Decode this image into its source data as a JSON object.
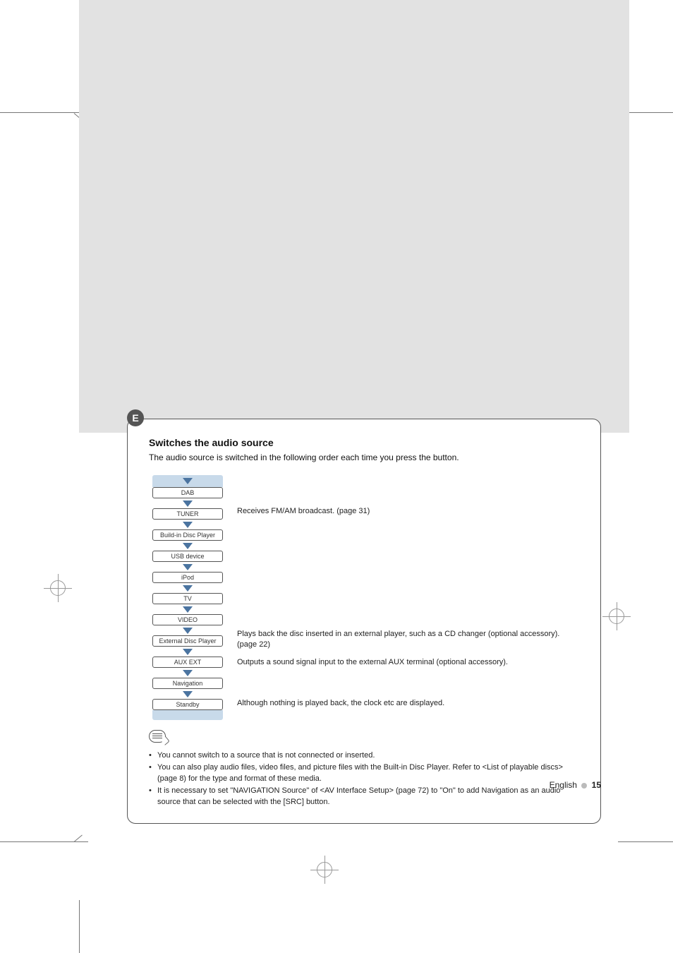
{
  "badge": "E",
  "title": "Switches the audio source",
  "subtitle": "The audio source is switched in the following order each time you press the button.",
  "flow": {
    "dab": "DAB",
    "tuner": "TUNER",
    "builtin": "Build-in Disc Player",
    "usb": "USB device",
    "ipod": "iPod",
    "tv": "TV",
    "video": "VIDEO",
    "external": "External Disc Player",
    "aux": "AUX EXT",
    "nav": "Navigation",
    "standby": "Standby"
  },
  "desc": {
    "tuner": "Receives FM/AM broadcast. (page 31)",
    "external": "Plays back the disc inserted in an external player, such as a CD changer (optional accessory). (page 22)",
    "aux": "Outputs a sound signal input to the external AUX terminal (optional accessory).",
    "standby": "Although nothing is played back, the clock etc are displayed."
  },
  "notes": [
    "You cannot switch to a source that is not connected or inserted.",
    "You can also play audio files, video files, and picture files with the Built-in Disc Player. Refer to <List of playable discs> (page 8) for the type and format of these media.",
    "It is necessary to set \"NAVIGATION Source\" of <AV Interface Setup> (page 72) to \"On\" to add Navigation as an audio source that can be selected with the [SRC] button."
  ],
  "footer": {
    "language": "English",
    "page": "15"
  }
}
